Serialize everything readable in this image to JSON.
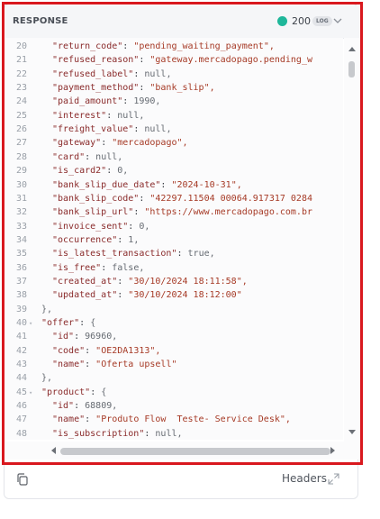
{
  "panel": {
    "title": "RESPONSE",
    "status_code": "200",
    "log_badge": "LOG",
    "status_color": "#1fb79a",
    "accent_border": "#d9181e"
  },
  "code": {
    "lines": [
      {
        "n": "20",
        "fold": "",
        "k": "\"return_code\"",
        "v": "\"pending_waiting_payment\",",
        "vt": "s"
      },
      {
        "n": "21",
        "fold": "",
        "k": "\"refused_reason\"",
        "v": "\"gateway.mercadopago.pending_w",
        "vt": "s"
      },
      {
        "n": "22",
        "fold": "",
        "k": "\"refused_label\"",
        "v": "null,",
        "vt": "n"
      },
      {
        "n": "23",
        "fold": "",
        "k": "\"payment_method\"",
        "v": "\"bank_slip\",",
        "vt": "s"
      },
      {
        "n": "24",
        "fold": "",
        "k": "\"paid_amount\"",
        "v": "1990,",
        "vt": "n"
      },
      {
        "n": "25",
        "fold": "",
        "k": "\"interest\"",
        "v": "null,",
        "vt": "n"
      },
      {
        "n": "26",
        "fold": "",
        "k": "\"freight_value\"",
        "v": "null,",
        "vt": "n"
      },
      {
        "n": "27",
        "fold": "",
        "k": "\"gateway\"",
        "v": "\"mercadopago\",",
        "vt": "s"
      },
      {
        "n": "28",
        "fold": "",
        "k": "\"card\"",
        "v": "null,",
        "vt": "n"
      },
      {
        "n": "29",
        "fold": "",
        "k": "\"is_card2\"",
        "v": "0,",
        "vt": "n"
      },
      {
        "n": "30",
        "fold": "",
        "k": "\"bank_slip_due_date\"",
        "v": "\"2024-10-31\",",
        "vt": "s"
      },
      {
        "n": "31",
        "fold": "",
        "k": "\"bank_slip_code\"",
        "v": "\"42297.11504 00064.917317 0284",
        "vt": "s"
      },
      {
        "n": "32",
        "fold": "",
        "k": "\"bank_slip_url\"",
        "v": "\"https://www.mercadopago.com.br",
        "vt": "s"
      },
      {
        "n": "33",
        "fold": "",
        "k": "\"invoice_sent\"",
        "v": "0,",
        "vt": "n"
      },
      {
        "n": "34",
        "fold": "",
        "k": "\"occurrence\"",
        "v": "1,",
        "vt": "n"
      },
      {
        "n": "35",
        "fold": "",
        "k": "\"is_latest_transaction\"",
        "v": "true,",
        "vt": "n"
      },
      {
        "n": "36",
        "fold": "",
        "k": "\"is_free\"",
        "v": "false,",
        "vt": "n"
      },
      {
        "n": "37",
        "fold": "",
        "k": "\"created_at\"",
        "v": "\"30/10/2024 18:11:58\",",
        "vt": "s"
      },
      {
        "n": "38",
        "fold": "",
        "k": "\"updated_at\"",
        "v": "\"30/10/2024 18:12:00\"",
        "vt": "s"
      },
      {
        "n": "39",
        "fold": "",
        "k": "",
        "v": "},",
        "vt": "n",
        "indent": 1
      },
      {
        "n": "40",
        "fold": "v",
        "k": "\"offer\"",
        "v": "{",
        "vt": "n",
        "indent": 1
      },
      {
        "n": "41",
        "fold": "",
        "k": "\"id\"",
        "v": "96960,",
        "vt": "n"
      },
      {
        "n": "42",
        "fold": "",
        "k": "\"code\"",
        "v": "\"OE2DA1313\",",
        "vt": "s"
      },
      {
        "n": "43",
        "fold": "",
        "k": "\"name\"",
        "v": "\"Oferta upsell\"",
        "vt": "s"
      },
      {
        "n": "44",
        "fold": "",
        "k": "",
        "v": "},",
        "vt": "n",
        "indent": 1
      },
      {
        "n": "45",
        "fold": "v",
        "k": "\"product\"",
        "v": "{",
        "vt": "n",
        "indent": 1
      },
      {
        "n": "46",
        "fold": "",
        "k": "\"id\"",
        "v": "68809,",
        "vt": "n"
      },
      {
        "n": "47",
        "fold": "",
        "k": "\"name\"",
        "v": "\"Produto Flow  Teste- Service Desk\",",
        "vt": "s"
      },
      {
        "n": "48",
        "fold": "",
        "k": "\"is_subscription\"",
        "v": "null,",
        "vt": "n"
      }
    ]
  },
  "footer": {
    "copy_icon": "copy-icon",
    "headers_label": "Headers",
    "expand_icon": "expand-icon"
  }
}
